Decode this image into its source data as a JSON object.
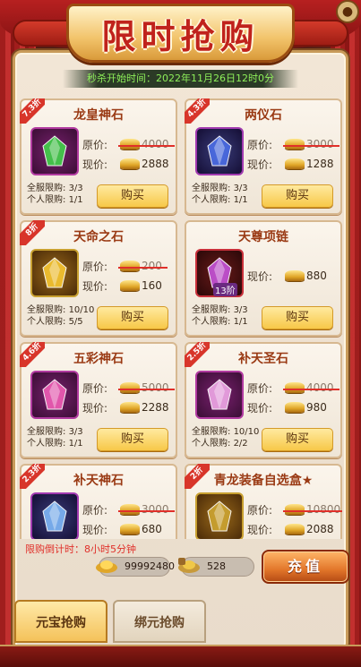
{
  "title": "限时抢购",
  "start_time": "秒杀开始时间：2022年11月26日12时0分",
  "labels": {
    "orig": "原价:",
    "cur": "现价:",
    "server_limit": "全服限购:",
    "personal_limit": "个人限购:",
    "buy": "购买"
  },
  "items": [
    {
      "name": "龙皇神石",
      "discount": "7.3折",
      "orig": "4000",
      "cur": "2888",
      "server": "3/3",
      "personal": "1/1",
      "icon": "green-crystal-icon",
      "icon_color": "#43c84a"
    },
    {
      "name": "两仪石",
      "discount": "4.3折",
      "orig": "3000",
      "cur": "1288",
      "server": "3/3",
      "personal": "1/1",
      "icon": "yin-yang-stone-icon",
      "icon_color": "#4a6ae0"
    },
    {
      "name": "天命之石",
      "discount": "8折",
      "orig": "200",
      "cur": "160",
      "server": "10/10",
      "personal": "5/5",
      "icon": "golden-shard-icon",
      "icon_color": "#f0c030"
    },
    {
      "name": "天尊项链",
      "discount": "",
      "badge": "13阶",
      "orig": "",
      "cur": "880",
      "server": "3/3",
      "personal": "1/1",
      "icon": "necklace-icon",
      "icon_color": "#c050d0"
    },
    {
      "name": "五彩神石",
      "discount": "4.6折",
      "orig": "5000",
      "cur": "2288",
      "server": "3/3",
      "personal": "1/1",
      "icon": "rainbow-crystal-icon",
      "icon_color": "#e85ab0"
    },
    {
      "name": "补天圣石",
      "discount": "2.5折",
      "orig": "4000",
      "cur": "980",
      "server": "10/10",
      "personal": "2/2",
      "icon": "pink-stone-icon",
      "icon_color": "#e8a0e0"
    },
    {
      "name": "补天神石",
      "discount": "2.3折",
      "orig": "3000",
      "cur": "680",
      "server": "",
      "personal": "",
      "icon": "blue-crystal-icon",
      "icon_color": "#7ab0f0"
    },
    {
      "name": "青龙装备自选盒★",
      "discount": "2折",
      "orig": "10800",
      "cur": "2088",
      "server": "",
      "personal": "",
      "icon": "dragon-box-icon",
      "icon_color": "#c8a030"
    }
  ],
  "countdown": "限购倒计时：8小时5分钟",
  "currency": {
    "gold": "99992480",
    "bound_gold": "528"
  },
  "recharge_label": "充值",
  "tabs": {
    "yuanbao": "元宝抢购",
    "bangyuan": "绑元抢购"
  },
  "close_symbol": "●"
}
